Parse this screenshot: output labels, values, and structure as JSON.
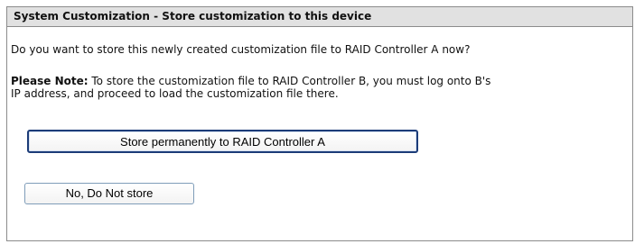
{
  "header": {
    "title": "System Customization - Store customization to this device"
  },
  "content": {
    "question": "Do you want to store this newly created customization file to RAID Controller A now?",
    "note_label": "Please Note:",
    "note_line1": " To store the customization file to RAID Controller B, you must log onto B's",
    "note_line2": "IP address, and proceed to load the customization file there."
  },
  "buttons": {
    "store_label": "Store permanently to RAID Controller A",
    "no_store_label": "No, Do Not store"
  }
}
